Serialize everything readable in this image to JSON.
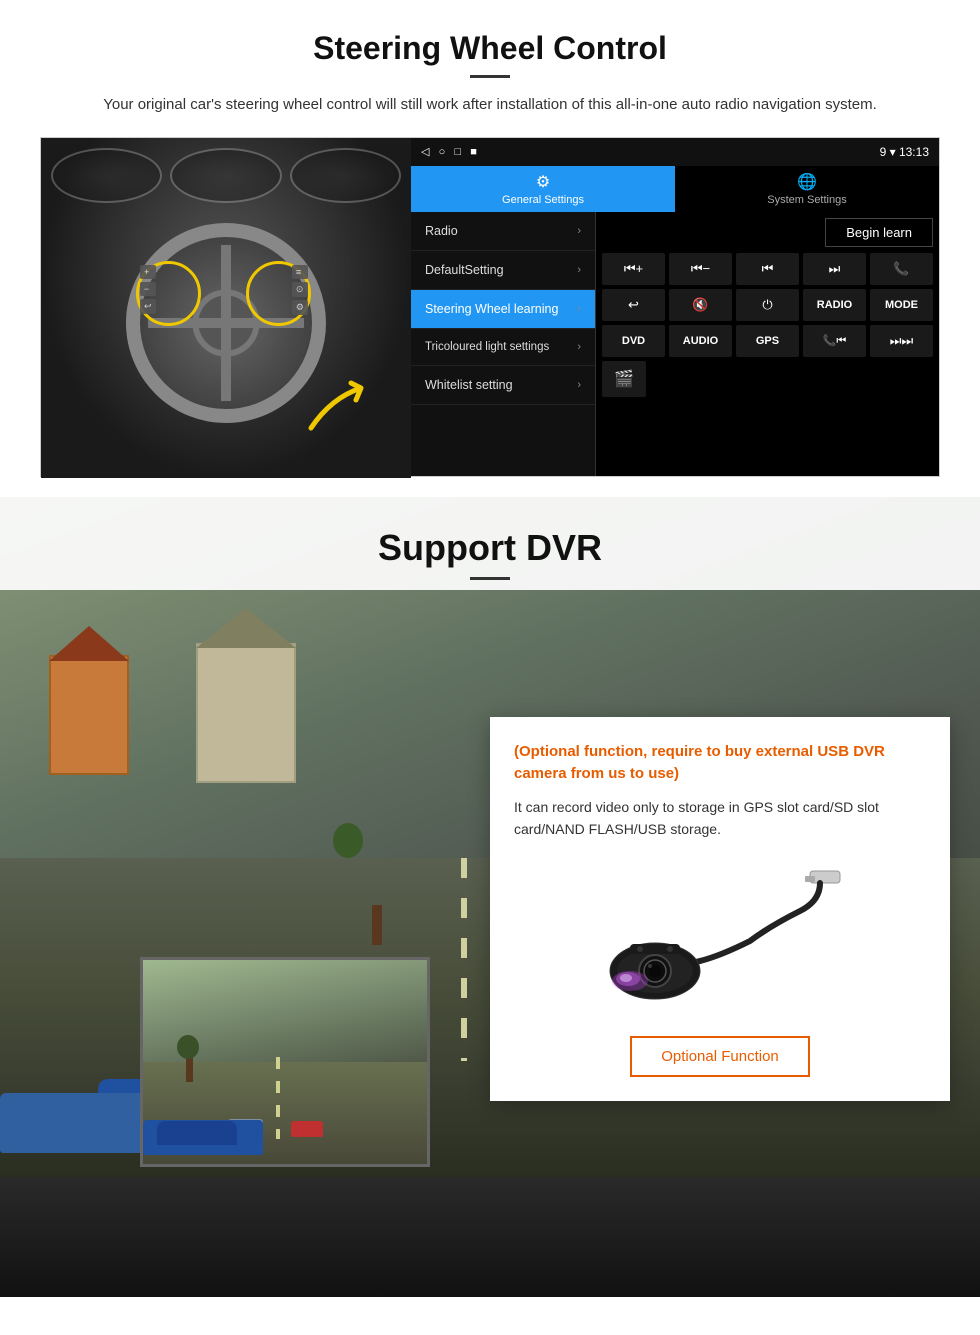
{
  "steering": {
    "title": "Steering Wheel Control",
    "subtitle": "Your original car's steering wheel control will still work after installation of this all-in-one auto radio navigation system.",
    "statusbar": {
      "icons": "◁  ○  □  ■",
      "status_right": "9 ▾ 13:13"
    },
    "tabs": [
      {
        "label": "General Settings",
        "icon": "⚙",
        "active": true
      },
      {
        "label": "System Settings",
        "icon": "🌐",
        "active": false
      }
    ],
    "menu_items": [
      {
        "label": "Radio",
        "active": false
      },
      {
        "label": "DefaultSetting",
        "active": false
      },
      {
        "label": "Steering Wheel learning",
        "active": true
      },
      {
        "label": "Tricoloured light settings",
        "active": false
      },
      {
        "label": "Whitelist setting",
        "active": false
      }
    ],
    "begin_learn_label": "Begin learn",
    "control_buttons": [
      "⏮+",
      "⏮-",
      "⏮",
      "⏭",
      "📞",
      "↩",
      "🔇",
      "⏻",
      "RADIO",
      "MODE",
      "DVD",
      "AUDIO",
      "GPS",
      "📞⏮",
      "⏭"
    ],
    "bottom_button": "🎬"
  },
  "dvr": {
    "title": "Support DVR",
    "optional_text": "(Optional function, require to buy external USB DVR camera from us to use)",
    "description": "It can record video only to storage in GPS slot card/SD slot card/NAND FLASH/USB storage.",
    "optional_fn_label": "Optional Function"
  }
}
